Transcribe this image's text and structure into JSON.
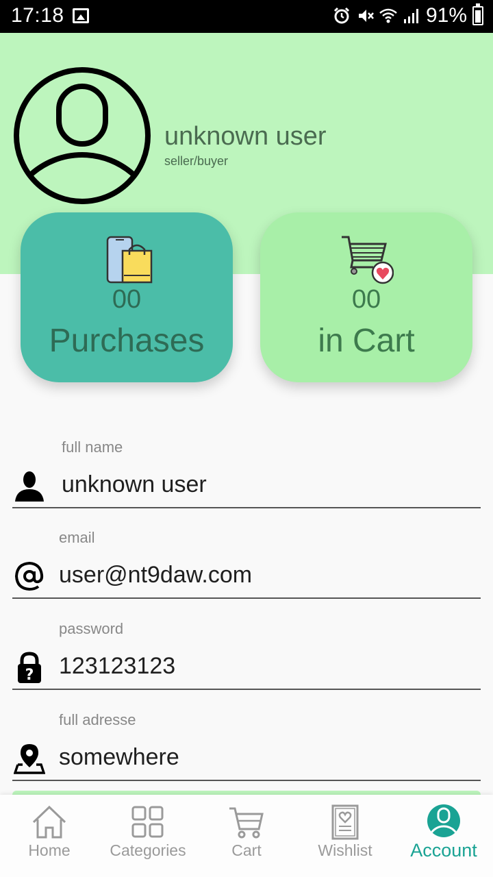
{
  "status_bar": {
    "time": "17:18",
    "battery": "91%",
    "icons": [
      "gallery-icon",
      "alarm-icon",
      "mute-icon",
      "wifi-icon",
      "signal-icon",
      "battery-icon"
    ]
  },
  "profile": {
    "name": "unknown user",
    "role": "seller/buyer",
    "avatar_icon": "user-circle-icon"
  },
  "cards": {
    "purchases": {
      "value": "00",
      "label": "Purchases",
      "icon": "phone-shopping-bag-icon",
      "color": "#4bbda8"
    },
    "cart": {
      "value": "00",
      "label": "in Cart",
      "icon": "cart-heart-icon",
      "color": "#a8efa8"
    }
  },
  "form": {
    "full_name": {
      "label": "full name",
      "value": "unknown user",
      "icon": "person-icon"
    },
    "email": {
      "label": "email",
      "value": "user@nt9daw.com",
      "icon": "at-icon"
    },
    "password": {
      "label": "password",
      "value": "123123123",
      "icon": "lock-question-icon"
    },
    "address": {
      "label": "full adresse",
      "value": "somewhere",
      "icon": "location-pin-icon"
    }
  },
  "nav": {
    "home": {
      "label": "Home",
      "icon": "home-icon"
    },
    "categories": {
      "label": "Categories",
      "icon": "grid-icon"
    },
    "cart": {
      "label": "Cart",
      "icon": "cart-icon"
    },
    "wishlist": {
      "label": "Wishlist",
      "icon": "wishlist-icon"
    },
    "account": {
      "label": "Account",
      "icon": "account-icon",
      "active": true
    }
  },
  "colors": {
    "header_bg": "#bdf5bd",
    "accent": "#1aa394"
  }
}
